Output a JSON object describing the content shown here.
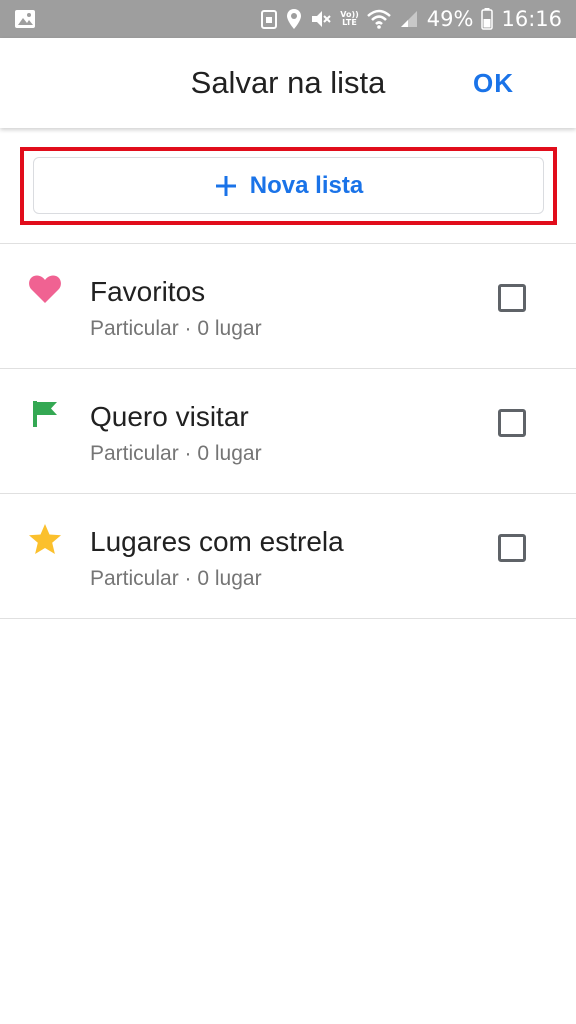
{
  "status_bar": {
    "battery": "49%",
    "time": "16:16",
    "volte_top": "Vo))",
    "volte_bottom": "LTE"
  },
  "header": {
    "title": "Salvar na lista",
    "ok_label": "OK"
  },
  "new_list": {
    "label": "Nova lista",
    "color": "#1a73e8",
    "highlight_color": "#e10d1b"
  },
  "lists": [
    {
      "icon": "heart-icon",
      "icon_color": "#f06292",
      "title": "Favoritos",
      "subtitle": "Particular · 0 lugar",
      "checked": false
    },
    {
      "icon": "flag-icon",
      "icon_color": "#34a853",
      "title": "Quero visitar",
      "subtitle": "Particular · 0 lugar",
      "checked": false
    },
    {
      "icon": "star-icon",
      "icon_color": "#fbc02d",
      "title": "Lugares com estrela",
      "subtitle": "Particular · 0 lugar",
      "checked": false
    }
  ]
}
